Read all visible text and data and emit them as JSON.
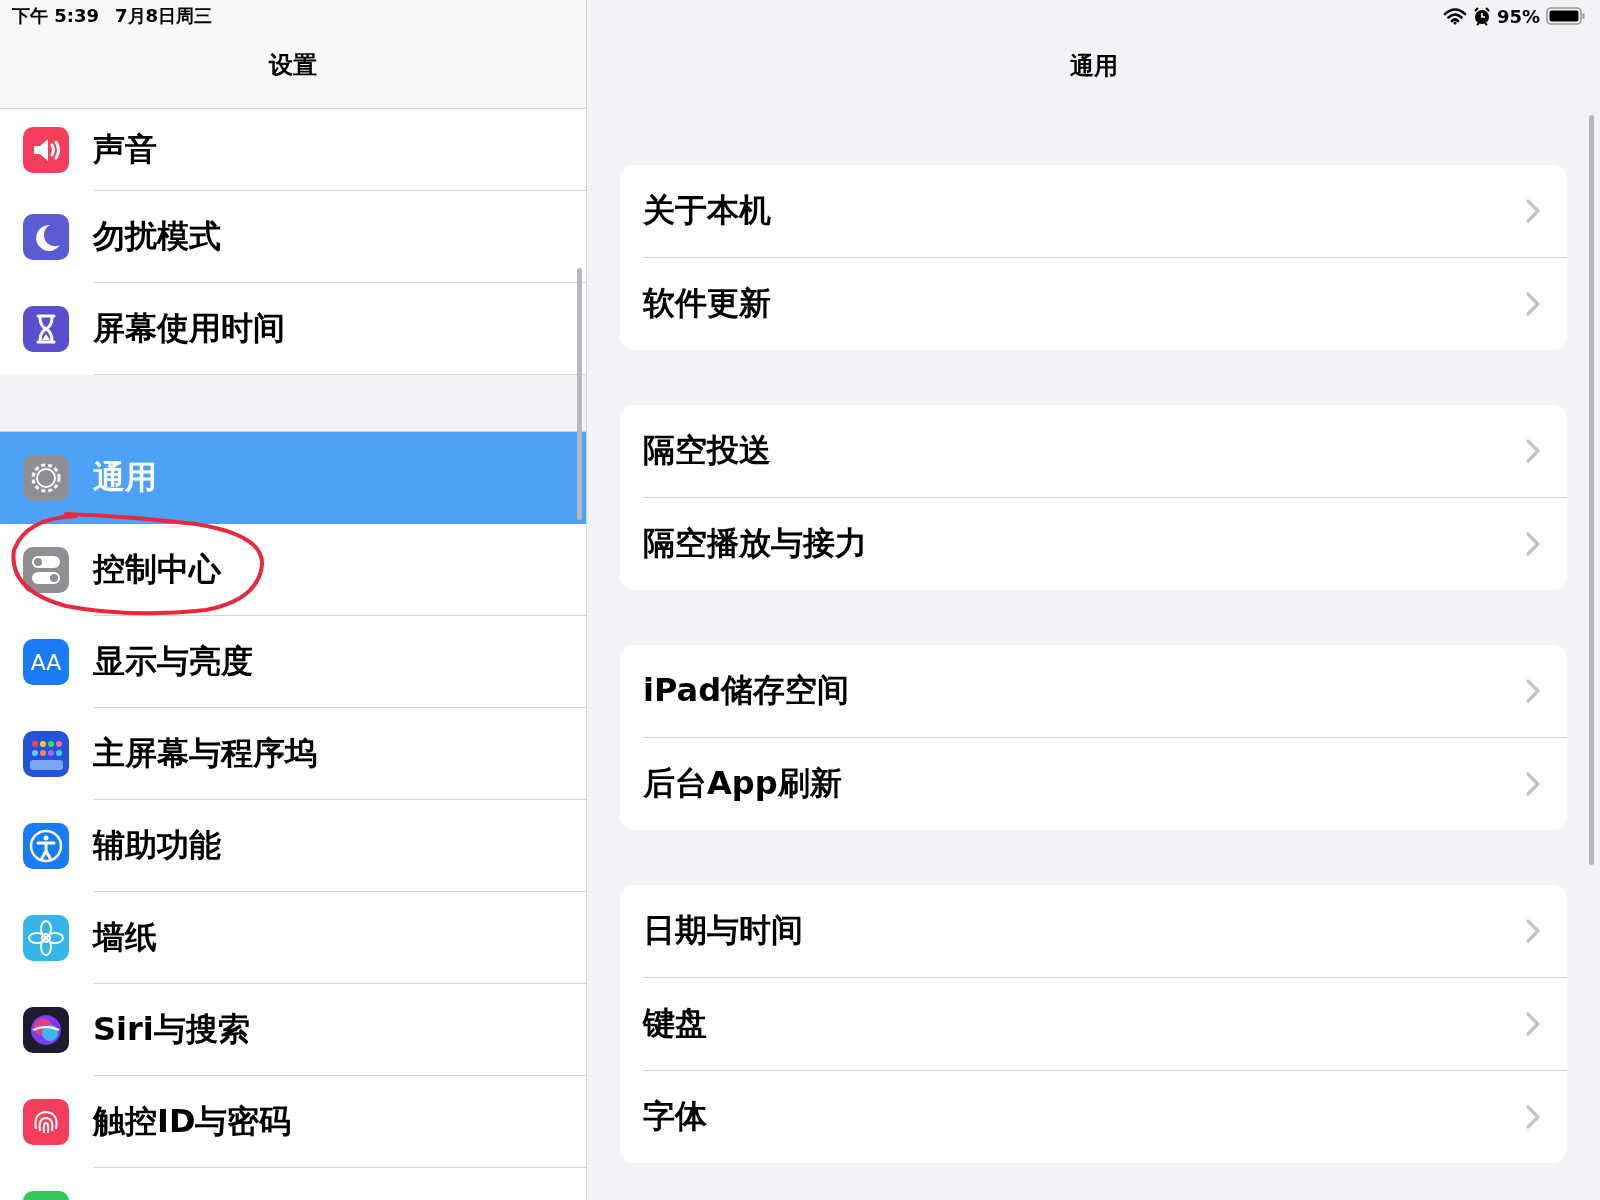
{
  "status_bar": {
    "time": "下午 5:39",
    "date": "7月8日周三",
    "battery": "95%"
  },
  "sidebar": {
    "title": "设置",
    "groups": [
      [
        {
          "label": "声音",
          "color": "#f43e5c",
          "selected": false
        },
        {
          "label": "勿扰模式",
          "color": "#5b5bd6",
          "selected": false
        },
        {
          "label": "屏幕使用时间",
          "color": "#5b4fd0",
          "selected": false
        }
      ],
      [
        {
          "label": "通用",
          "color": "#8e8e93",
          "selected": true
        },
        {
          "label": "控制中心",
          "color": "#8e8e93",
          "selected": false
        },
        {
          "label": "显示与亮度",
          "color": "#1a7cf5",
          "selected": false,
          "icon_text": "AA"
        },
        {
          "label": "主屏幕与程序坞",
          "color": "#2452d8",
          "selected": false
        },
        {
          "label": "辅助功能",
          "color": "#1a7cf5",
          "selected": false
        },
        {
          "label": "墙纸",
          "color": "#36b6e8",
          "selected": false
        },
        {
          "label": "Siri与搜索",
          "color": "#1c1c2e",
          "selected": false
        },
        {
          "label": "触控ID与密码",
          "color": "#f43e5c",
          "selected": false
        },
        {
          "color": "#34c759"
        }
      ]
    ]
  },
  "detail": {
    "title": "通用",
    "groups": [
      [
        {
          "label": "关于本机"
        },
        {
          "label": "软件更新"
        }
      ],
      [
        {
          "label": "隔空投送"
        },
        {
          "label": "隔空播放与接力"
        }
      ],
      [
        {
          "label": "iPad储存空间"
        },
        {
          "label": "后台App刷新"
        }
      ],
      [
        {
          "label": "日期与时间"
        },
        {
          "label": "键盘"
        },
        {
          "label": "字体"
        }
      ]
    ]
  }
}
